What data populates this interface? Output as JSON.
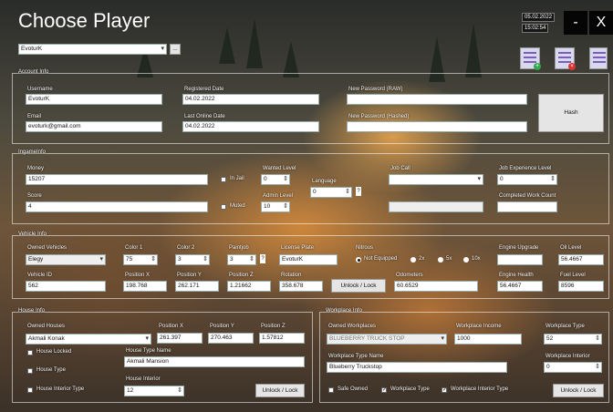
{
  "window": {
    "title": "Choose Player",
    "date": "05.02.2022",
    "time": "15:02:54",
    "minimize": "-",
    "close": "X"
  },
  "player_select": {
    "value": "EvoturK",
    "browse": "..."
  },
  "toolbar_icons": [
    "db-add-icon",
    "db-delete-icon",
    "db-edit-icon"
  ],
  "account": {
    "group": "Account Info",
    "username_label": "Username",
    "username": "EvoturK",
    "email_label": "Email",
    "email": "evoturk@gmail.com",
    "registered_label": "Registered Date",
    "registered": "04.02.2022",
    "last_online_label": "Last Online Date",
    "last_online": "04.02.2022",
    "new_pw_label": "New Password (RAW)",
    "new_pw": "",
    "new_pw_hashed_label": "New Password (Hashed)",
    "new_pw_hashed": "",
    "hash_button": "Hash"
  },
  "ingame": {
    "group": "IngameInfo",
    "money_label": "Money",
    "money": "15207",
    "score_label": "Score",
    "score": "4",
    "in_jail_label": "In Jail",
    "muted_label": "Muted",
    "wanted_label": "Wanted Level",
    "wanted": "0",
    "admin_label": "Admin Level",
    "admin": "10",
    "language_label": "Language",
    "language": "0",
    "job_label": "Job Call",
    "job": "",
    "job_xp_label": "Job Experience Level",
    "job_xp": "0",
    "completed_label": "Completed Work Count",
    "completed": ""
  },
  "vehicle": {
    "group": "Vehicle Info",
    "owned_label": "Owned Vehicles",
    "owned": "Elegy",
    "color1_label": "Color 1",
    "color1": "75",
    "color2_label": "Color 2",
    "color2": "3",
    "paintjob_label": "Paintjob",
    "paintjob": "3",
    "plate_label": "License Plate",
    "plate": "EvoturK",
    "nitrous_label": "Nitrous",
    "nitrous_options": [
      "Not Equipped",
      "2x",
      "5x",
      "10x"
    ],
    "engine_upgrade_label": "Engine Upgrade",
    "engine_upgrade": "",
    "oil_label": "Oil Level",
    "oil": "56.4667",
    "vid_label": "Vehicle ID",
    "vid": "562",
    "px_label": "Position X",
    "px": "198.768",
    "py_label": "Position Y",
    "py": "262.171",
    "pz_label": "Position Z",
    "pz": "1.21662",
    "rot_label": "Rotation",
    "rot": "358.678",
    "unlock": "Unlock / Lock",
    "odo_label": "Odometers",
    "odo": "60.6529",
    "engine_health_label": "Engine Health",
    "engine_health": "56.4667",
    "fuel_label": "Fuel Level",
    "fuel": "8596"
  },
  "house": {
    "group": "House Info",
    "owned_label": "Owned Houses",
    "owned": "Akmali Konak",
    "px_label": "Position X",
    "px": "261.397",
    "py_label": "Position Y",
    "py": "270.463",
    "pz_label": "Position Z",
    "pz": "1.57812",
    "locked_label": "House Locked",
    "type_label": "House Type",
    "interior_type_label": "House Interior Type",
    "type_name_label": "House Type Name",
    "type_name": "Akmali Mansion",
    "interior_label": "House Interior",
    "interior": "12",
    "unlock": "Unlock / Lock"
  },
  "workplace": {
    "group": "Workplace Info",
    "owned_label": "Owned Workplaces",
    "owned": "BLUEBERRY TRUCK STOP",
    "income_label": "Workplace Income",
    "income": "1000",
    "type_label": "Workplace Type",
    "type": "52",
    "type_name_label": "Workplace Type Name",
    "type_name": "Blueberry Truckstop",
    "interior_label": "Workplace Interior",
    "interior": "0",
    "safe_label": "Safe Owned",
    "wtype_check_label": "Workplace Type",
    "winterior_check_label": "Workplace Interior Type",
    "unlock": "Unlock / Lock"
  }
}
